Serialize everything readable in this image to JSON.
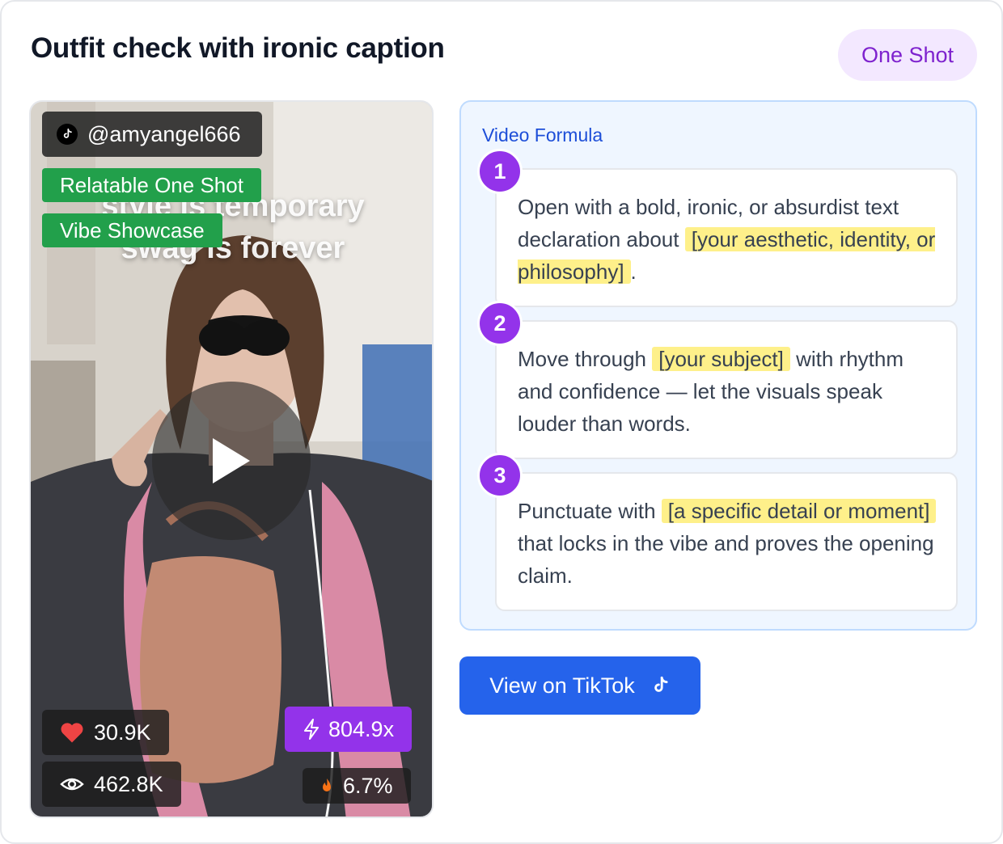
{
  "card": {
    "title": "Outfit check with ironic caption",
    "type_pill": "One Shot"
  },
  "video": {
    "handle": "@amyangel666",
    "overlay_caption": [
      "style is temporary",
      "swag is forever"
    ],
    "tags": [
      "Relatable One Shot",
      "Vibe Showcase"
    ],
    "stats": {
      "likes": "30.9K",
      "views": "462.8K",
      "multiplier": "804.9x",
      "engagement": "6.7%"
    }
  },
  "formula": {
    "label": "Video Formula",
    "steps": [
      {
        "number": "1",
        "text_before": "Open with a bold, ironic, or absurdist text declaration about ",
        "highlight": "[your aesthetic, identity, or philosophy]",
        "text_after": "."
      },
      {
        "number": "2",
        "text_before": "Move through ",
        "highlight": "[your subject]",
        "text_after": " with rhythm and confidence — let the visuals speak louder than words."
      },
      {
        "number": "3",
        "text_before": "Punctuate with ",
        "highlight": "[a specific detail or moment]",
        "text_after": " that locks in the vibe and proves the opening claim."
      }
    ]
  },
  "cta": {
    "label": "View on TikTok"
  },
  "colors": {
    "accent_purple": "#9333ea",
    "tag_green": "#22a04b",
    "cta_blue": "#2563eb",
    "highlight_yellow": "#fef08a",
    "pill_bg": "#f3e8ff"
  },
  "icons": [
    "tiktok-icon",
    "play-icon",
    "heart-icon",
    "eye-icon",
    "bolt-icon",
    "flame-icon"
  ]
}
